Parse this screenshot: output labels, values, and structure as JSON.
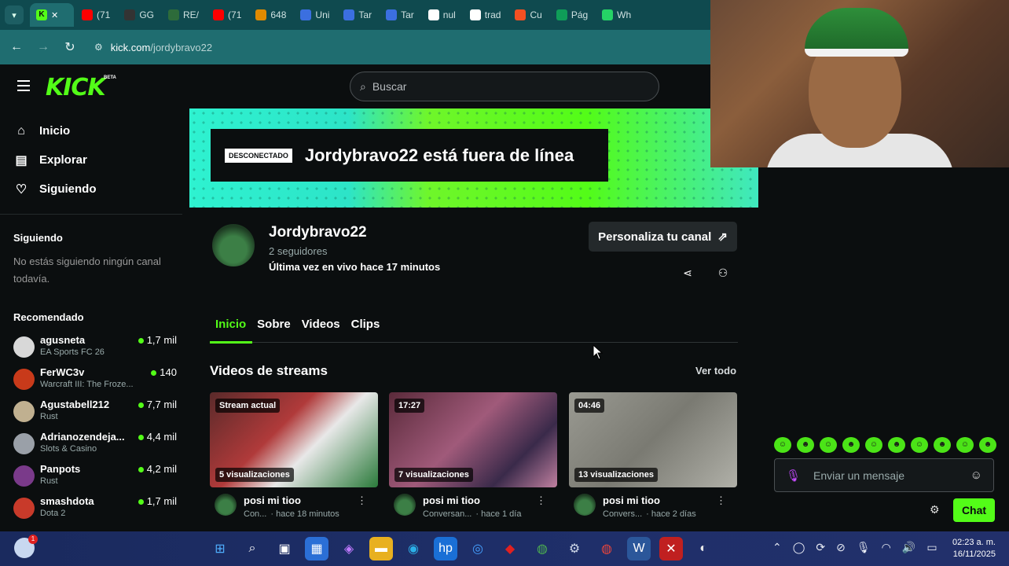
{
  "browser": {
    "tabs": [
      {
        "label": "(71",
        "color": "#ff0000"
      },
      {
        "label": "GG",
        "color": "#333333"
      },
      {
        "label": "RE/",
        "color": "#2d6b3a"
      },
      {
        "label": "(71",
        "color": "#ff0000"
      },
      {
        "label": "648",
        "color": "#e08a00"
      },
      {
        "label": "Uni",
        "color": "#3b6fe0"
      },
      {
        "label": "Tar",
        "color": "#3b6fe0"
      },
      {
        "label": "Tar",
        "color": "#3b6fe0"
      },
      {
        "label": "nul",
        "color": "#ffffff"
      },
      {
        "label": "trad",
        "color": "#ffffff"
      },
      {
        "label": "Cu",
        "color": "#f25022"
      },
      {
        "label": "Pág",
        "color": "#0f9d58"
      },
      {
        "label": "Wh",
        "color": "#25d366"
      }
    ],
    "active_tab_icon": "K",
    "close_glyph": "✕",
    "dropdown_glyph": "▾",
    "url_domain": "kick.com",
    "url_path": "/jordybravo22"
  },
  "kick": {
    "logo": "KICK",
    "logo_badge": "BETA",
    "search_placeholder": "Buscar",
    "nav": [
      {
        "label": "Inicio",
        "icon": "⌂"
      },
      {
        "label": "Explorar",
        "icon": "▤"
      },
      {
        "label": "Siguiendo",
        "icon": "♡"
      }
    ],
    "following_title": "Siguiendo",
    "following_empty": "No estás siguiendo ningún canal todavía.",
    "recommended_title": "Recomendado",
    "recommended": [
      {
        "name": "agusneta",
        "category": "EA Sports FC 26",
        "viewers": "1,7 mil",
        "color": "#d8d8d8"
      },
      {
        "name": "FerWC3v",
        "category": "Warcraft III: The Froze...",
        "viewers": "140",
        "color": "#c83a1a"
      },
      {
        "name": "Agustabell212",
        "category": "Rust",
        "viewers": "7,7 mil",
        "color": "#c0b090"
      },
      {
        "name": "Adrianozendeja...",
        "category": "Slots & Casino",
        "viewers": "4,4 mil",
        "color": "#9aa0a8"
      },
      {
        "name": "Panpots",
        "category": "Rust",
        "viewers": "4,2 mil",
        "color": "#7a3a8a"
      },
      {
        "name": "smashdota",
        "category": "Dota 2",
        "viewers": "1,7 mil",
        "color": "#c83a2a"
      }
    ],
    "banner": {
      "badge": "DESCONECTADO",
      "text": "Jordybravo22 está fuera de línea"
    },
    "channel": {
      "name": "Jordybravo22",
      "followers": "2 seguidores",
      "last_live": "Última vez en vivo hace 17 minutos",
      "customize_label": "Personaliza tu canal",
      "customize_icon": "⇗"
    },
    "tabs": [
      "Inicio",
      "Sobre",
      "Videos",
      "Clips"
    ],
    "videos_title": "Videos de streams",
    "see_all": "Ver todo",
    "videos": [
      {
        "tag": "Stream actual",
        "views": "5 visualizaciones",
        "title": "posi mi tioo",
        "category": "Con...",
        "time": "· hace 18 minutos",
        "bg": "linear-gradient(135deg,#5a2a2a,#b03a3a 40%,#e8e8e8 60%,#2a7a3a)"
      },
      {
        "tag": "17:27",
        "views": "7 visualizaciones",
        "title": "posi mi tioo",
        "category": "Conversan...",
        "time": "· hace 1 día",
        "bg": "linear-gradient(135deg,#5a2a3a,#a05a7a 45%,#3a2a4a 75%,#c080a0)"
      },
      {
        "tag": "04:46",
        "views": "13 visualizaciones",
        "title": "posi mi tioo",
        "category": "Convers...",
        "time": "· hace 2 días",
        "bg": "linear-gradient(135deg,#9a9a92,#7a7a72 50%,#b0b0a8)"
      }
    ]
  },
  "chat": {
    "placeholder": "Enviar un mensaje",
    "send_label": "Chat",
    "emotes": [
      "☺",
      "☻",
      "☺",
      "☻",
      "☺",
      "☻",
      "☺",
      "☻",
      "☺",
      "☻"
    ]
  },
  "taskbar": {
    "weather_badge": "1",
    "time": "02:23 a. m.",
    "date": "16/11/2025",
    "apps": [
      {
        "name": "start",
        "glyph": "⊞",
        "bg": "transparent",
        "color": "#4fb0ff"
      },
      {
        "name": "search",
        "glyph": "⌕",
        "bg": "transparent",
        "color": "#ffffff"
      },
      {
        "name": "task-view",
        "glyph": "▣",
        "bg": "transparent",
        "color": "#ffffff"
      },
      {
        "name": "store",
        "glyph": "▦",
        "bg": "#2b6fd6",
        "color": "#ffffff"
      },
      {
        "name": "copilot",
        "glyph": "◈",
        "bg": "transparent",
        "color": "#c07aff"
      },
      {
        "name": "explorer",
        "glyph": "▬",
        "bg": "#e8b020",
        "color": "#ffffff"
      },
      {
        "name": "edge",
        "glyph": "◉",
        "bg": "transparent",
        "color": "#2bb0e8"
      },
      {
        "name": "hp",
        "glyph": "hp",
        "bg": "#1a6fd6",
        "color": "#ffffff"
      },
      {
        "name": "app",
        "glyph": "◎",
        "bg": "transparent",
        "color": "#44a0ff"
      },
      {
        "name": "mcafee",
        "glyph": "◆",
        "bg": "transparent",
        "color": "#e02020"
      },
      {
        "name": "chrome",
        "glyph": "◍",
        "bg": "transparent",
        "color": "#4caf50"
      },
      {
        "name": "settings",
        "glyph": "⚙",
        "bg": "transparent",
        "color": "#cfd8e8"
      },
      {
        "name": "chrome-2",
        "glyph": "◍",
        "bg": "transparent",
        "color": "#e8453c"
      },
      {
        "name": "word",
        "glyph": "W",
        "bg": "#2b579a",
        "color": "#ffffff"
      },
      {
        "name": "access",
        "glyph": "✕",
        "bg": "#c02020",
        "color": "#ffffff"
      },
      {
        "name": "obs",
        "glyph": "◐",
        "bg": "transparent",
        "color": "#e8e8e8"
      }
    ],
    "tray": [
      "⌃",
      "◯",
      "⟳",
      "⊘",
      "🎙",
      "◠",
      "🔊",
      "▭"
    ]
  }
}
